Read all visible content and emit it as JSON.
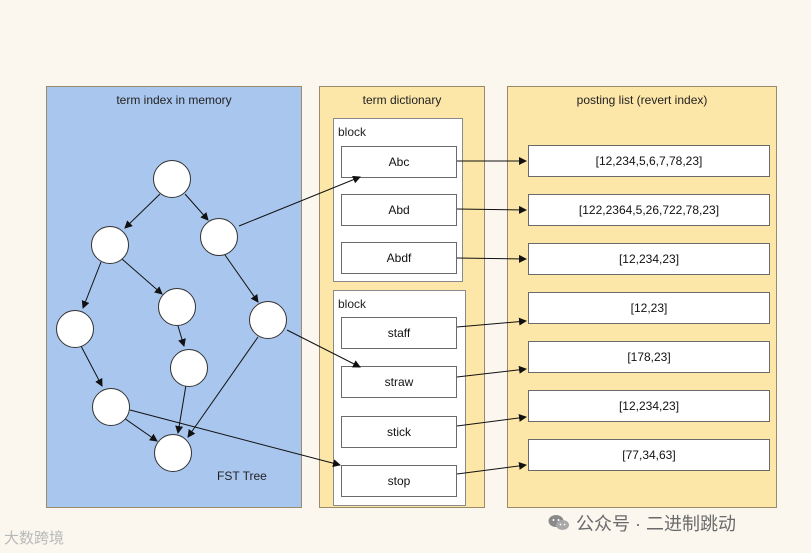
{
  "fst_panel": {
    "title": "term index in memory",
    "caption": "FST Tree",
    "color": "#a9c6ee"
  },
  "dict_panel": {
    "title": "term dictionary",
    "color": "#fce6a8",
    "blocks": [
      {
        "label": "block",
        "terms": [
          "Abc",
          "Abd",
          "Abdf"
        ]
      },
      {
        "label": "block",
        "terms": [
          "staff",
          "straw",
          "stick",
          "stop"
        ]
      }
    ]
  },
  "postings_panel": {
    "title": "posting list  (revert index)",
    "color": "#fce6a8",
    "lists": [
      "[12,234,5,6,7,78,23]",
      "[122,2364,5,26,722,78,23]",
      "[12,234,23]",
      "[12,23]",
      "[178,23]",
      "[12,234,23]",
      "[77,34,63]"
    ]
  },
  "watermarks": {
    "left": "大数跨境",
    "right": "公众号 · 二进制跳动"
  }
}
